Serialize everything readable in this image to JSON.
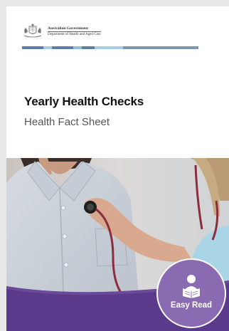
{
  "header": {
    "logo": {
      "icon": "coat-of-arms-icon",
      "line1": "Australian Government",
      "line2": "Department of Health and Aged Care"
    },
    "stripe_colors": [
      "#5b7fa8",
      "#5b7fa8",
      "#8fc0d6",
      "#5b7fa8",
      "#a4d1e0",
      "#a4d1e0",
      "#7b97b8"
    ]
  },
  "cover": {
    "title": "Yearly Health Checks",
    "subtitle": "Health Fact Sheet"
  },
  "photo": {
    "icon": "stethoscope-exam-photo",
    "band_color": "#5b3a8c"
  },
  "badge": {
    "icon": "reader-with-book-icon",
    "label": "Easy Read",
    "color": "#8a6bb1"
  }
}
